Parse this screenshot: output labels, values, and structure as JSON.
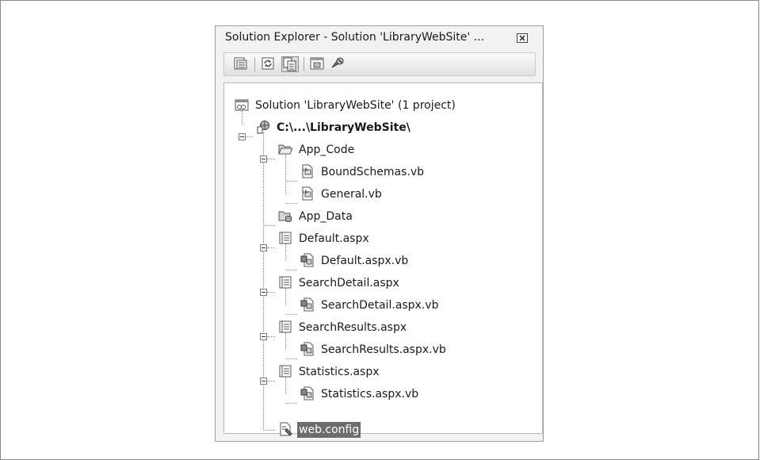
{
  "panel": {
    "title": "Solution Explorer - Solution 'LibraryWebSite' ...",
    "toolbar": {
      "buttons": [
        "properties-icon",
        "refresh-icon",
        "show-all-files-icon",
        "view-designer-icon",
        "wcf-configure-icon"
      ]
    }
  },
  "tree": {
    "solution": "Solution 'LibraryWebSite' (1 project)",
    "project": "C:\\...\\LibraryWebSite\\",
    "app_code": "App_Code",
    "bound_schemas": "BoundSchemas.vb",
    "general": "General.vb",
    "app_data": "App_Data",
    "default_aspx": "Default.aspx",
    "default_aspx_vb": "Default.aspx.vb",
    "search_detail_aspx": "SearchDetail.aspx",
    "search_detail_aspx_vb": "SearchDetail.aspx.vb",
    "search_results_aspx": "SearchResults.aspx",
    "search_results_aspx_vb": "SearchResults.aspx.vb",
    "statistics_aspx": "Statistics.aspx",
    "statistics_aspx_vb": "Statistics.aspx.vb",
    "web_config": "web.config"
  },
  "colors": {
    "selection": "#6d6d6d",
    "panel_bg": "#f2f2f2"
  }
}
